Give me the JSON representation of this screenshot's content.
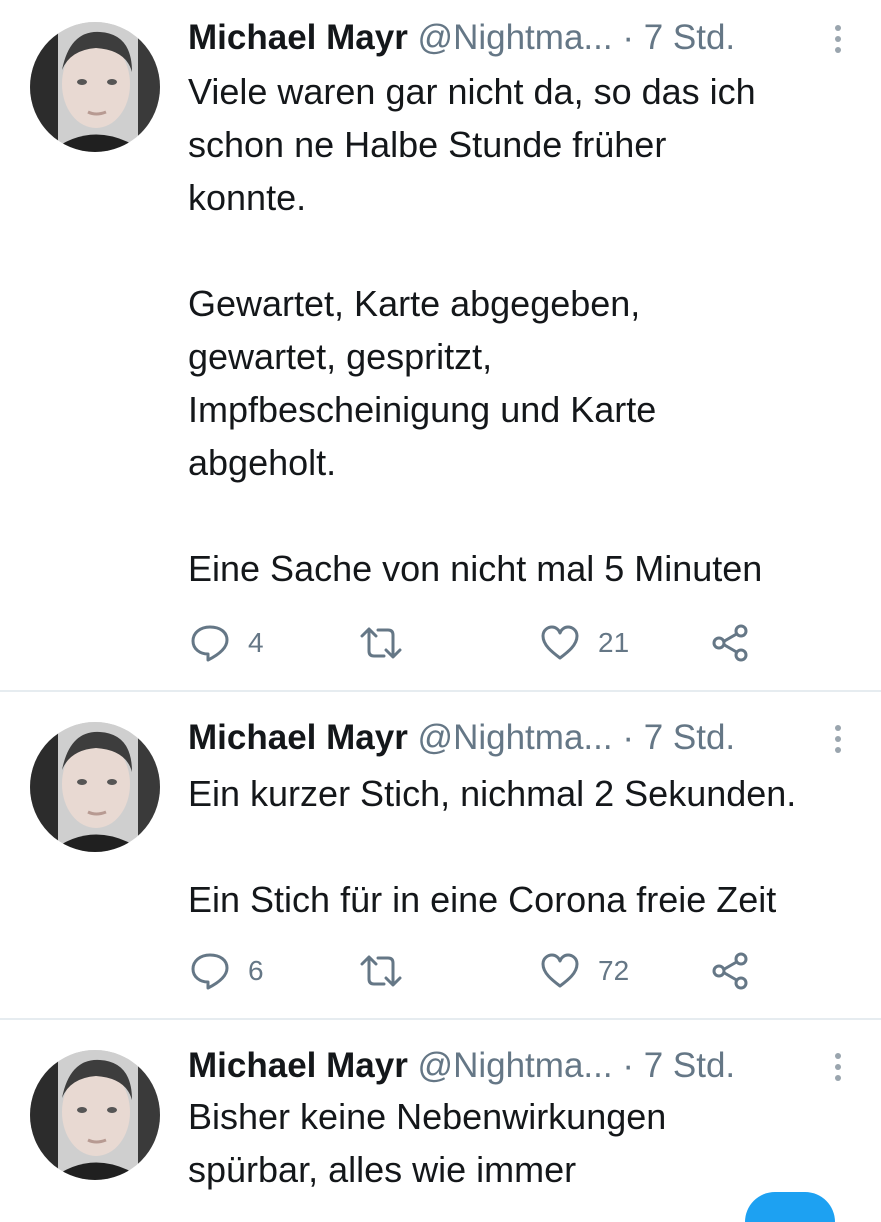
{
  "tweets": [
    {
      "author_name": "Michael Mayr",
      "handle": "@Nightma...",
      "separator": "·",
      "time": "7 Std.",
      "paragraphs": [
        [
          "Viele waren gar nicht da, so das ich",
          "schon ne Halbe Stunde früher",
          "konnte."
        ],
        [
          "Gewartet, Karte abgegeben,",
          "gewartet, gespritzt,",
          "Impfbescheinigung und Karte",
          "abgeholt."
        ],
        [
          "Eine Sache von nicht mal 5 Minuten"
        ]
      ],
      "reply_count": "4",
      "retweet_count": "",
      "like_count": "21"
    },
    {
      "author_name": "Michael Mayr",
      "handle": "@Nightma...",
      "separator": "·",
      "time": "7 Std.",
      "paragraphs": [
        [
          "Ein kurzer Stich, nichmal 2 Sekunden."
        ],
        [
          "Ein Stich für in eine Corona freie Zeit"
        ]
      ],
      "reply_count": "6",
      "retweet_count": "",
      "like_count": "72"
    },
    {
      "author_name": "Michael Mayr",
      "handle": "@Nightma...",
      "separator": "·",
      "time": "7 Std.",
      "paragraphs": [
        [
          "Bisher keine Nebenwirkungen",
          "spürbar, alles wie immer"
        ]
      ]
    }
  ],
  "icons": {
    "reply": "reply-icon",
    "retweet": "retweet-icon",
    "like": "heart-icon",
    "share": "share-icon",
    "more": "more-vertical-icon"
  },
  "colors": {
    "text": "#14171a",
    "secondary": "#657786",
    "divider": "#e6ecf0",
    "accent": "#1da1f2"
  }
}
